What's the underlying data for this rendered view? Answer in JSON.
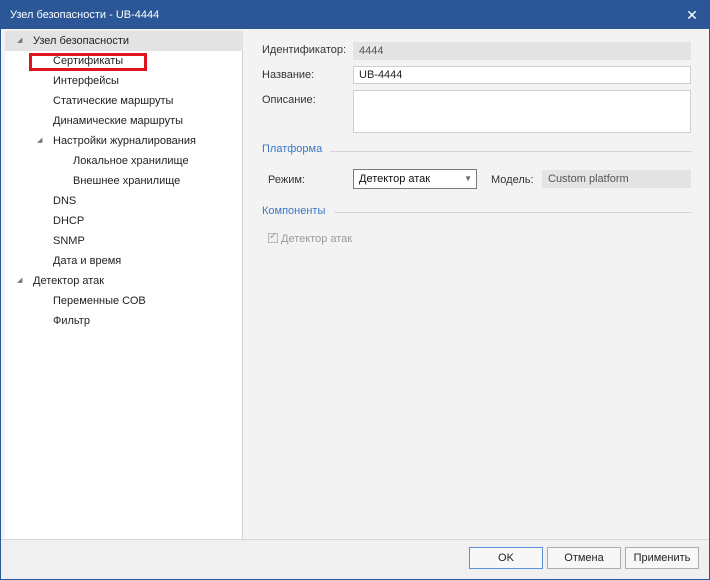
{
  "window": {
    "title": "Узел безопасности - UB-4444",
    "close_glyph": "✕"
  },
  "tree": {
    "collapse_glyph": "◢",
    "items": [
      {
        "label": "Узел безопасности"
      },
      {
        "label": "Сертификаты"
      },
      {
        "label": "Интерфейсы"
      },
      {
        "label": "Статические маршруты"
      },
      {
        "label": "Динамические маршруты"
      },
      {
        "label": "Настройки журналирования"
      },
      {
        "label": "Локальное хранилище"
      },
      {
        "label": "Внешнее хранилище"
      },
      {
        "label": "DNS"
      },
      {
        "label": "DHCP"
      },
      {
        "label": "SNMP"
      },
      {
        "label": "Дата и время"
      },
      {
        "label": "Детектор атак"
      },
      {
        "label": "Переменные СОВ"
      },
      {
        "label": "Фильтр"
      }
    ]
  },
  "form": {
    "identifier_label": "Идентификатор:",
    "identifier_value": "4444",
    "name_label": "Название:",
    "name_value": "UB-4444",
    "description_label": "Описание:",
    "description_value": "",
    "platform_section": "Платформа",
    "mode_label": "Режим:",
    "mode_value": "Детектор атак",
    "model_label": "Модель:",
    "model_value": "Custom platform",
    "components_section": "Компоненты",
    "component_ids_label": "Детектор атак",
    "component_ids_checked": true
  },
  "footer": {
    "ok_label": "OK",
    "cancel_label": "Отмена",
    "apply_label": "Применить"
  },
  "colors": {
    "titlebar": "#2b5797",
    "section": "#3a78c7",
    "highlight": "#e0141e"
  },
  "icons": {
    "expand_arrow": "collapse-triangle-icon",
    "dropdown_arrow": "chevron-down-icon",
    "close": "close-icon",
    "checkbox": "checkmark-icon"
  }
}
